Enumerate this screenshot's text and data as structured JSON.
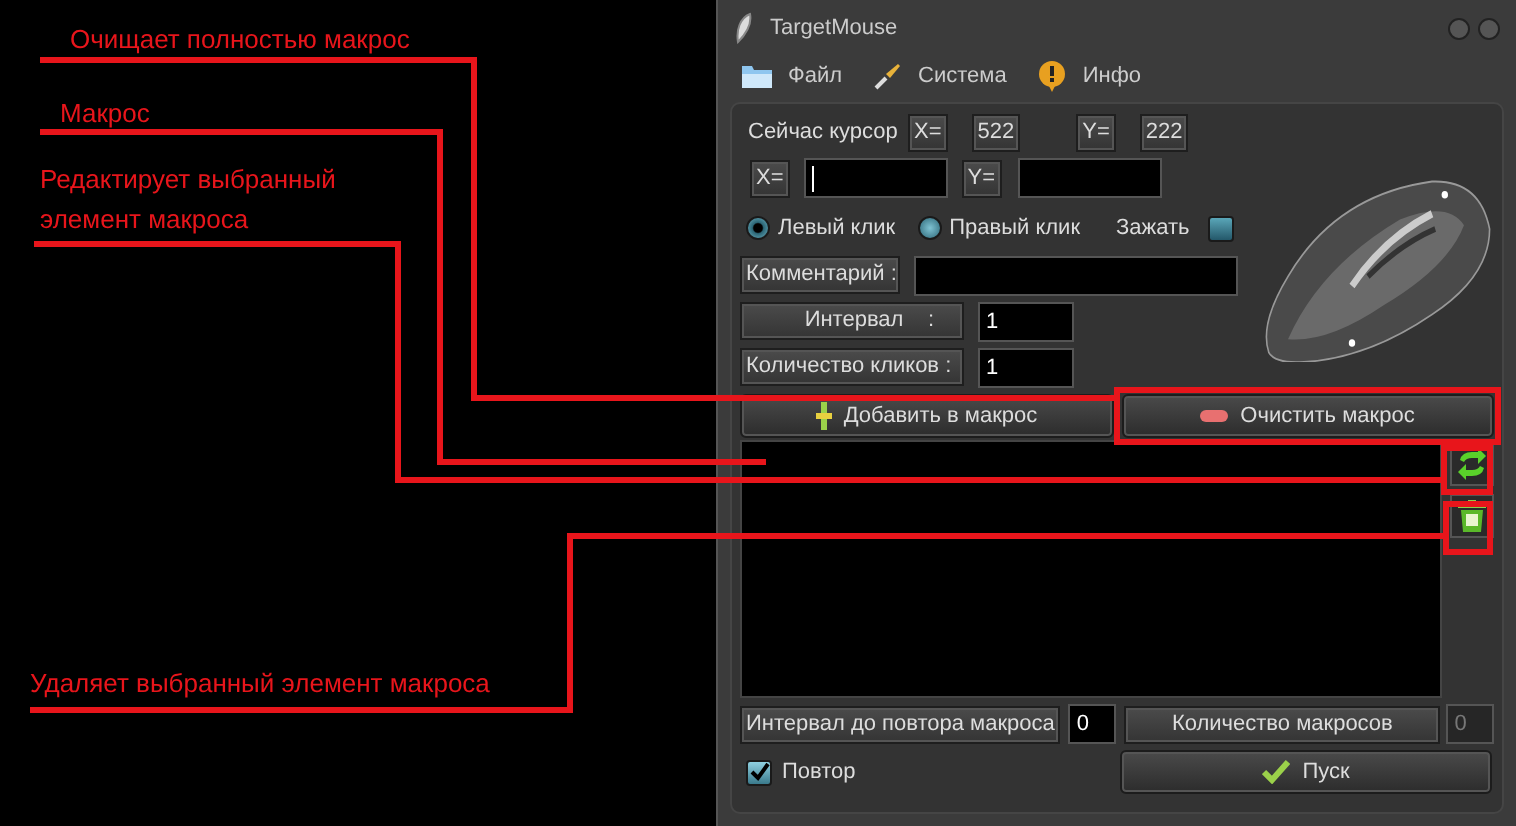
{
  "annotations": [
    {
      "text": "Очищает полностью макрос"
    },
    {
      "text": "Макрос"
    },
    {
      "text": "Редактирует выбранный элемент макроса"
    },
    {
      "text": "Удаляет выбранный элемент макроса"
    }
  ],
  "window": {
    "title": "TargetMouse"
  },
  "menu": [
    {
      "label": "Файл"
    },
    {
      "label": "Система"
    },
    {
      "label": "Инфо"
    }
  ],
  "cursor": {
    "label": "Сейчас курсор",
    "x_label": "X=",
    "x_value": "522",
    "y_label": "Y=",
    "y_value": "222"
  },
  "target": {
    "x_label": "X=",
    "y_label": "Y="
  },
  "click_type": [
    {
      "label": "Левый клик",
      "selected": true
    },
    {
      "label": "Правый клик",
      "selected": false
    }
  ],
  "hold": {
    "label": "Зажать",
    "checked": false
  },
  "fields": [
    {
      "label": "Комментарий :"
    },
    {
      "label": "Интервал    :",
      "value": "1"
    },
    {
      "label": "Количество кликов :",
      "value": "1"
    }
  ],
  "buttons": [
    {
      "label": "Добавить в макрос",
      "kind": "add"
    },
    {
      "label": "Очистить макрос",
      "kind": "clear"
    }
  ],
  "repeat_interval": {
    "label": "Интервал до повтора макроса",
    "value": "0"
  },
  "macro_count": {
    "label": "Количество макросов",
    "value": "0",
    "disabled": true
  },
  "repeat": {
    "label": "Повтор",
    "checked": true
  },
  "start_button": {
    "label": "Пуск"
  }
}
